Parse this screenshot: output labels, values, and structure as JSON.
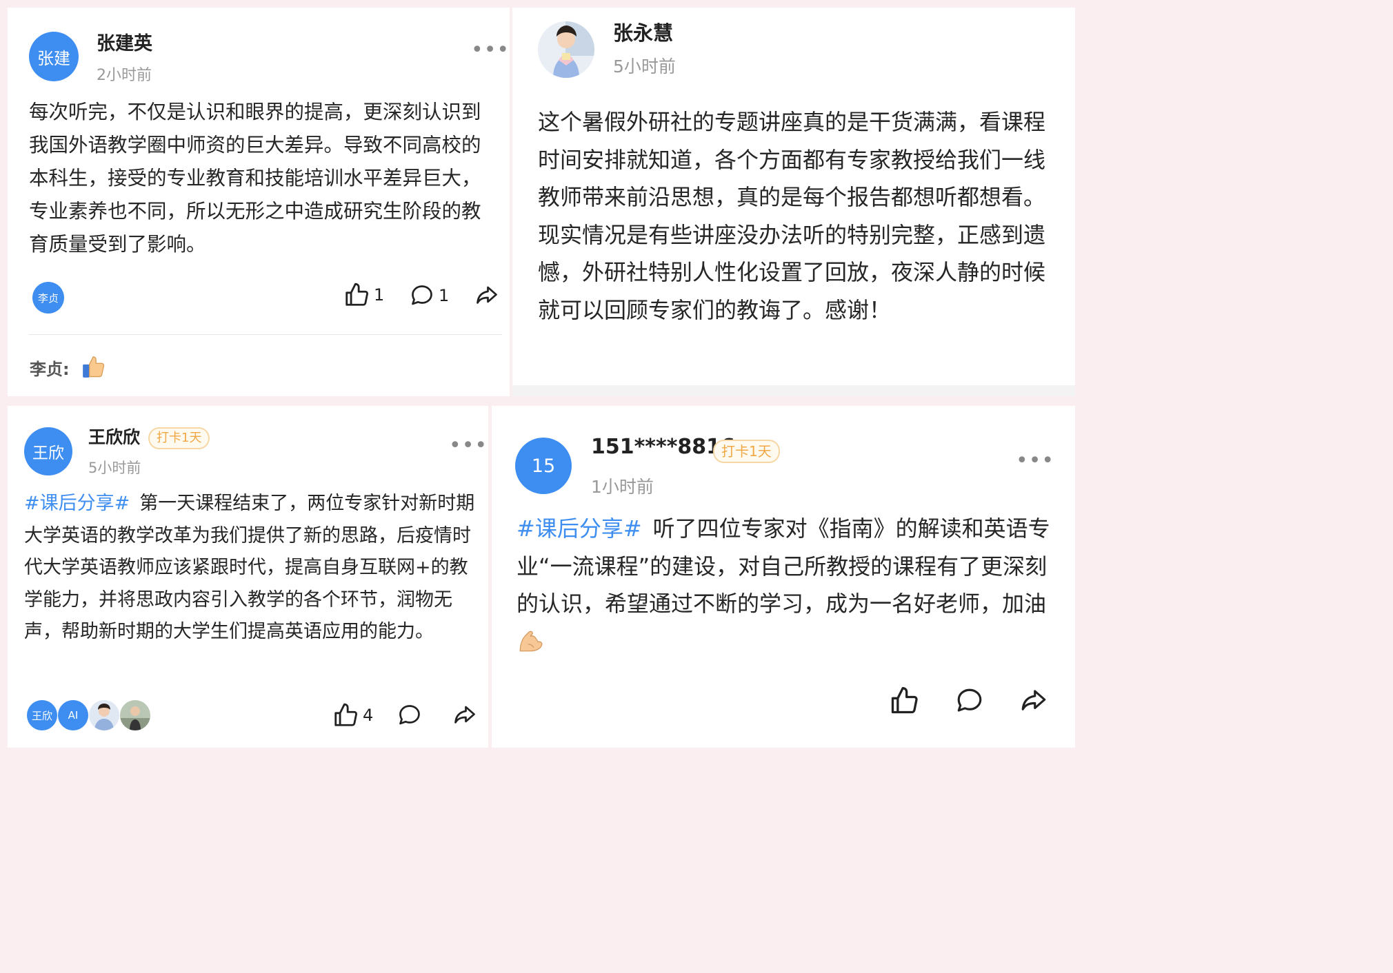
{
  "cards": [
    {
      "author": "张建英",
      "avatar_text": "张建",
      "time": "2小时前",
      "text": "每次听完，不仅是认识和眼界的提高，更深刻认识到我国外语教学圈中师资的巨大差异。导致不同高校的本科生，接受的专业教育和技能培训水平差异巨大，专业素养也不同，所以无形之中造成研究生阶段的教育质量受到了影响。",
      "likers": [
        "李贞"
      ],
      "like_count": "1",
      "comment_count": "1",
      "comment": {
        "author": "李贞:",
        "content_icon": "thumbs-up-emoji"
      }
    },
    {
      "author": "张永慧",
      "avatar_icon": "user-photo-girl",
      "time": "5小时前",
      "text": "这个暑假外研社的专题讲座真的是干货满满，看课程时间安排就知道，各个方面都有专家教授给我们一线教师带来前沿思想，真的是每个报告都想听都想看。现实情况是有些讲座没办法听的特别完整，正感到遗憾，外研社特别人性化设置了回放，夜深人静的时候就可以回顾专家们的教诲了。感谢！"
    },
    {
      "author": "王欣欣",
      "avatar_text": "王欣",
      "badge": "打卡1天",
      "time": "5小时前",
      "tag": "#课后分享#",
      "text": "第一天课程结束了，两位专家针对新时期大学英语的教学改革为我们提供了新的思路，后疫情时代大学英语教师应该紧跟时代，提高自身互联网+的教学能力，并将思政内容引入教学的各个环节，润物无声，帮助新时期的大学生们提高英语应用的能力。",
      "likers": [
        "王欣",
        "AI"
      ],
      "like_count": "4"
    },
    {
      "author": "151****8816",
      "avatar_text": "15",
      "badge": "打卡1天",
      "time": "1小时前",
      "tag": "#课后分享#",
      "text": "听了四位专家对《指南》的解读和英语专业“一流课程”的建设，对自己所教授的课程有了更深刻的认识，希望通过不断的学习，成为一名好老师，加油"
    }
  ],
  "colors": {
    "accent": "#3d8ef0",
    "badge": "#f1a743",
    "background": "#fbeef0"
  }
}
